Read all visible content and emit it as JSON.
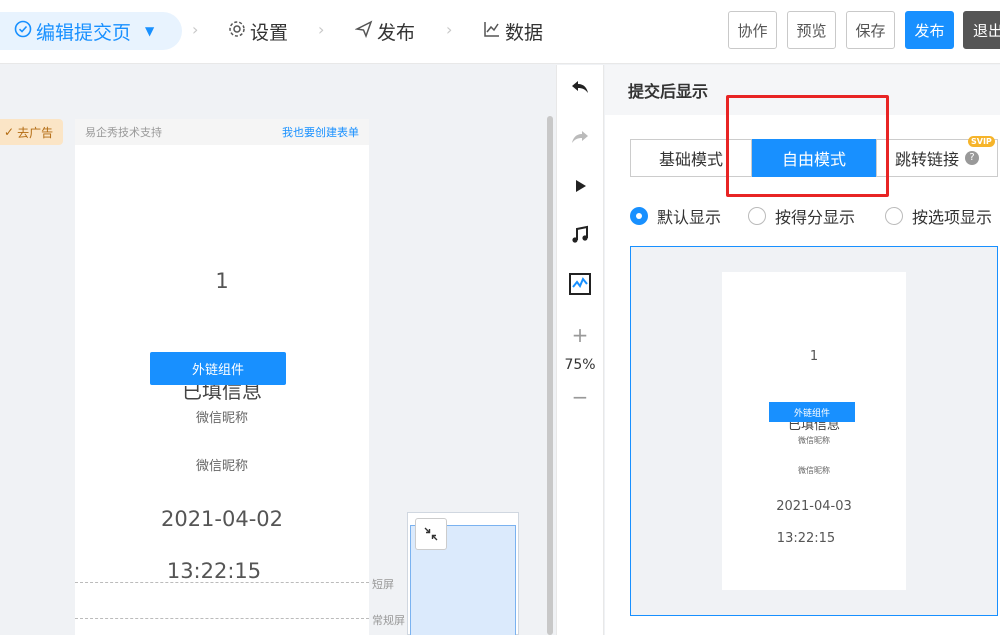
{
  "header": {
    "steps": {
      "edit": "编辑提交页",
      "settings": "设置",
      "publish": "发布",
      "data": "数据"
    },
    "buttons": {
      "collaborate": "协作",
      "preview": "预览",
      "save": "保存",
      "publish": "发布",
      "exit": "退出"
    }
  },
  "canvas": {
    "ad_tag": "去广告",
    "phone": {
      "powered_by": "易企秀技术支持",
      "create_link": "我也要创建表单",
      "number": "1",
      "link_button": "外链组件",
      "filled_info": "已填信息",
      "nickname_1": "微信昵称",
      "nickname_2": "微信昵称",
      "date": "2021-04-02",
      "time": "13:22:15"
    },
    "guides": {
      "short_screen": "短屏",
      "normal_screen": "常规屏"
    }
  },
  "tools": {
    "zoom": "75%"
  },
  "panel": {
    "title": "提交后显示",
    "modes": {
      "basic": "基础模式",
      "free": "自由模式",
      "redirect": "跳转链接",
      "badge": "SVIP"
    },
    "radios": {
      "default": "默认显示",
      "by_score": "按得分显示",
      "by_option": "按选项显示"
    },
    "preview": {
      "number": "1",
      "link_button": "外链组件",
      "filled_info": "已填信息",
      "nickname_1": "微信昵称",
      "nickname_2": "微信昵称",
      "date": "2021-04-03",
      "time": "13:22:15"
    }
  },
  "colors": {
    "primary": "#1890ff",
    "highlight": "#e82424",
    "badge": "#f6b42a"
  }
}
